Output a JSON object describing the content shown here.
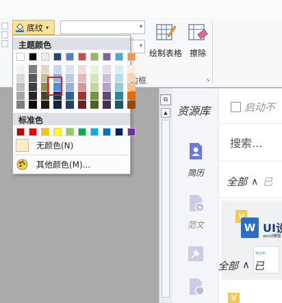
{
  "ribbon": {
    "shading_label": "底纹",
    "shading_caret": "▾",
    "combo_arrow": "▾",
    "draw_table_label": "绘制表格",
    "erase_label": "擦除",
    "group_label": "边框",
    "dialog_launcher": "↘"
  },
  "dropdown": {
    "theme_title": "主题颜色",
    "standard_title": "标准色",
    "no_color_label": "无颜色(N)",
    "more_colors_label": "其他颜色(M)...",
    "theme_top": [
      "#ffffff",
      "#000000",
      "#eeece1",
      "#1f497d",
      "#4f81bd",
      "#c0504d",
      "#9bbb59",
      "#8064a2",
      "#4bacc6",
      "#f79646"
    ],
    "theme_shades": [
      [
        "#f2f2f2",
        "#d8d8d8",
        "#bfbfbf",
        "#a5a5a5",
        "#7f7f7f"
      ],
      [
        "#7f7f7f",
        "#595959",
        "#3f3f3f",
        "#262626",
        "#0c0c0c"
      ],
      [
        "#ddd9c3",
        "#c4bd97",
        "#938953",
        "#494429",
        "#1d1b10"
      ],
      [
        "#c6d9f0",
        "#8db3e2",
        "#548dd4",
        "#17365d",
        "#0f243e"
      ],
      [
        "#dbe5f1",
        "#b8cce4",
        "#95b3d7",
        "#366092",
        "#244061"
      ],
      [
        "#f2dcdb",
        "#e5b9b7",
        "#d99694",
        "#953734",
        "#632423"
      ],
      [
        "#ebf1dd",
        "#d7e3bc",
        "#c3d69b",
        "#76923c",
        "#4f6128"
      ],
      [
        "#e5e0ec",
        "#ccc1d9",
        "#b2a2c7",
        "#5f497a",
        "#3f3151"
      ],
      [
        "#dbeef3",
        "#b7dde8",
        "#92cddc",
        "#31859b",
        "#205867"
      ],
      [
        "#fdeada",
        "#fbd5b5",
        "#fac08f",
        "#e36c09",
        "#974806"
      ]
    ],
    "standard": [
      "#c00000",
      "#ff0000",
      "#ffc000",
      "#ffff00",
      "#92d050",
      "#00b050",
      "#00b0f0",
      "#0070c0",
      "#002060",
      "#7030a0"
    ]
  },
  "resource_panel": {
    "title": "资源库",
    "auto_start": "启动不",
    "search_placeholder": "搜索...",
    "filter_all": "全部",
    "filter_chevron": "∧",
    "filter_more": "已",
    "nav": [
      {
        "label": "简历"
      },
      {
        "label": "范文"
      }
    ],
    "card": {
      "badge": "V",
      "word_icon": "W",
      "title": "UI设",
      "subtitle": "word模板",
      "sample_text": "可小牛"
    },
    "ghost_all": "全部",
    "ghost_chevron": "∧",
    "ghost_more": "已"
  }
}
